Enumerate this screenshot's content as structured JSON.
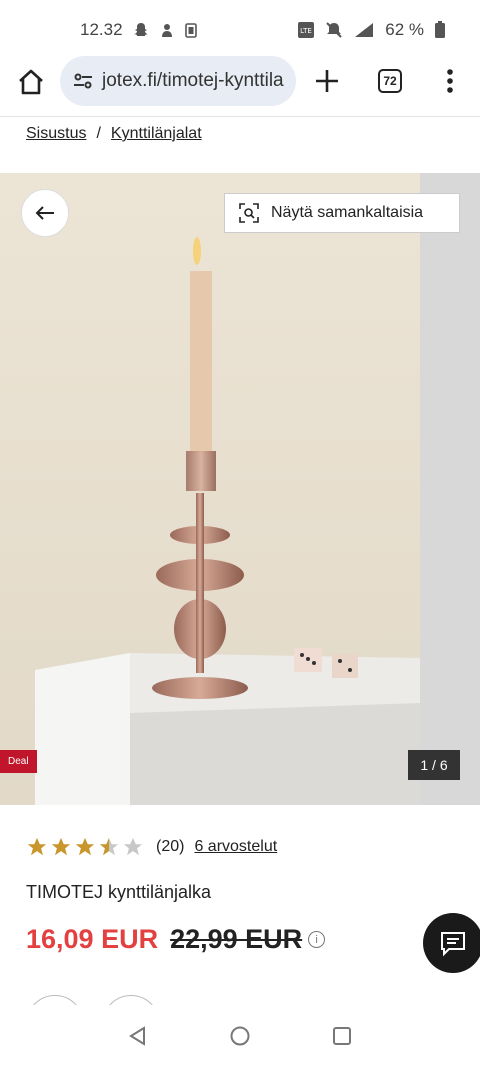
{
  "status": {
    "time": "12.32",
    "battery": "62 %"
  },
  "browser": {
    "url": "jotex.fi/timotej-kynttila",
    "tab_count": "72"
  },
  "breadcrumb": {
    "items": [
      "Sisustus",
      "Kynttilänjalat"
    ],
    "separator": "/"
  },
  "gallery": {
    "similar_label": "Näytä samankaltaisia",
    "deal_label": "Deal",
    "counter": "1 / 6"
  },
  "product": {
    "rating": 3.5,
    "rating_count": "(20)",
    "reviews_label": "6 arvostelut",
    "title": "TIMOTEJ kynttilänjalka",
    "price_now": "16,09 EUR",
    "price_old": "22,99 EUR",
    "info_icon": "i"
  },
  "colors": {
    "sale": "#e34040",
    "deal": "#c0152a",
    "star": "#c9962b"
  }
}
